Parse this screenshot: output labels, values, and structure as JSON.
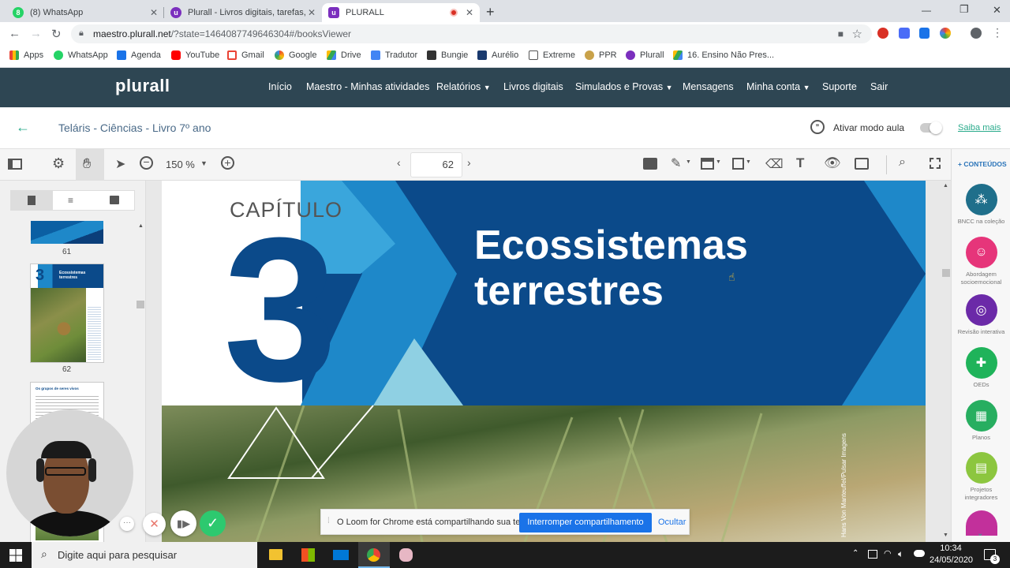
{
  "browser": {
    "tabs": [
      {
        "label": "(8) WhatsApp",
        "icon": "whatsapp-icon",
        "color": "#25d366"
      },
      {
        "label": "Plurall - Livros digitais, tarefas, tu",
        "icon": "plurall-icon",
        "color": "#7b2fbe"
      },
      {
        "label": "PLURALL",
        "icon": "plurall-icon",
        "color": "#7b2fbe"
      }
    ],
    "url_host": "maestro.plurall.net",
    "url_path": "/?state=1464087749646304#/booksViewer",
    "bookmarks": [
      "Apps",
      "WhatsApp",
      "Agenda",
      "YouTube",
      "Gmail",
      "Google",
      "Drive",
      "Tradutor",
      "Bungie",
      "Aurélio",
      "Extreme",
      "PPR",
      "Plurall",
      "16. Ensino Não Pres..."
    ]
  },
  "site": {
    "logo": "plurall",
    "menu": [
      {
        "label": "Início",
        "dropdown": false
      },
      {
        "label": "Maestro - Minhas atividades",
        "dropdown": false
      },
      {
        "label": "Relatórios",
        "dropdown": true
      },
      {
        "label": "Livros digitais",
        "dropdown": false
      },
      {
        "label": "Simulados e Provas",
        "dropdown": true
      },
      {
        "label": "Mensagens",
        "dropdown": false
      },
      {
        "label": "Minha conta",
        "dropdown": true
      },
      {
        "label": "Suporte",
        "dropdown": false
      },
      {
        "label": "Sair",
        "dropdown": false
      }
    ],
    "book_title": "Teláris - Ciências - Livro 7º ano",
    "class_mode_label": "Ativar modo aula",
    "learn_more": "Saiba mais"
  },
  "viewer": {
    "zoom": "150 %",
    "page": "62",
    "conteudos": "+ CONTEÚDOS",
    "thumbs": [
      {
        "label": "61"
      },
      {
        "label": "62"
      }
    ],
    "page_content": {
      "chapter_word": "CAPÍTULO",
      "chapter_number": "3",
      "title_line1": "Ecossistemas",
      "title_line2": "terrestres",
      "photo_credit": "Hans Von Manteuffel/Pulsar Imagens"
    },
    "thumb_text": {
      "p62_title": "Ecossistemas terrestres",
      "p63_title": "Os grupos de seres vivos"
    }
  },
  "right_panel": [
    {
      "label": "BNCC na coleção",
      "color": "#1f6f8b",
      "icon": "network-icon"
    },
    {
      "label": "Abordagem socioemocional",
      "color": "#e6357a",
      "icon": "faces-icon"
    },
    {
      "label": "Revisão interativa",
      "color": "#6b2aa8",
      "icon": "instagram-icon"
    },
    {
      "label": "OEDs",
      "color": "#1fb35a",
      "icon": "puzzle-icon"
    },
    {
      "label": "Planos",
      "color": "#27ae60",
      "icon": "calendar-icon"
    },
    {
      "label": "Projetos integradores",
      "color": "#8cc63f",
      "icon": "document-icon"
    }
  ],
  "loom": {
    "message": "O Loom for Chrome está compartilhando sua tela.",
    "stop": "Interromper compartilhamento",
    "hide": "Ocultar"
  },
  "taskbar": {
    "search": "Digite aqui para pesquisar",
    "time": "10:34",
    "date": "24/05/2020",
    "notif": "3"
  }
}
